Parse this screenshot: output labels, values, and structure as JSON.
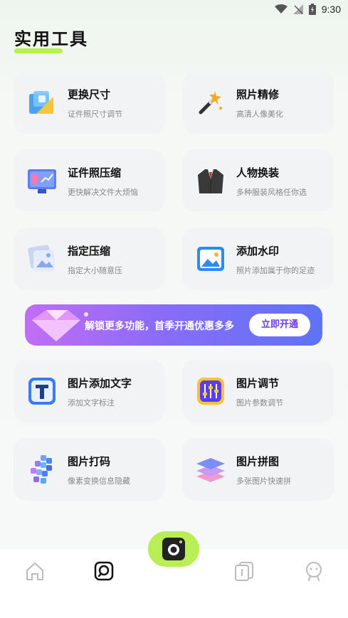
{
  "status": {
    "time": "9:30"
  },
  "page": {
    "title": "实用工具"
  },
  "cards": [
    {
      "title": "更换尺寸",
      "subtitle": "证件照尺寸调节"
    },
    {
      "title": "照片精修",
      "subtitle": "高清人像美化"
    },
    {
      "title": "证件照压缩",
      "subtitle": "更快解决文件大烦恼"
    },
    {
      "title": "人物换装",
      "subtitle": "多种服装风格任你选"
    },
    {
      "title": "指定压缩",
      "subtitle": "指定大小随意压"
    },
    {
      "title": "添加水印",
      "subtitle": "照片添加属于你的足迹"
    },
    {
      "title": "图片添加文字",
      "subtitle": "添加文字标注"
    },
    {
      "title": "图片调节",
      "subtitle": "图片参数调节"
    },
    {
      "title": "图片打码",
      "subtitle": "像素变换信息隐藏"
    },
    {
      "title": "图片拼图",
      "subtitle": "多张图片快速拼"
    }
  ],
  "banner": {
    "text": "解锁更多功能，首季开通优惠多多",
    "button": "立即开通"
  },
  "icons": {
    "card_icons": [
      "resize-icon",
      "magic-wand-icon",
      "monitor-chart-icon",
      "suit-icon",
      "photo-stack-icon",
      "picture-icon",
      "text-T-icon",
      "sliders-icon",
      "mosaic-icon",
      "layers-icon"
    ],
    "tabs": [
      "home-icon",
      "tools-icon",
      "camera-icon",
      "gallery-icon",
      "profile-icon"
    ]
  },
  "colors": {
    "accent": "#b6f24e",
    "banner_start": "#c26df5",
    "banner_end": "#5e73f5",
    "button_text": "#6a3cf2"
  }
}
